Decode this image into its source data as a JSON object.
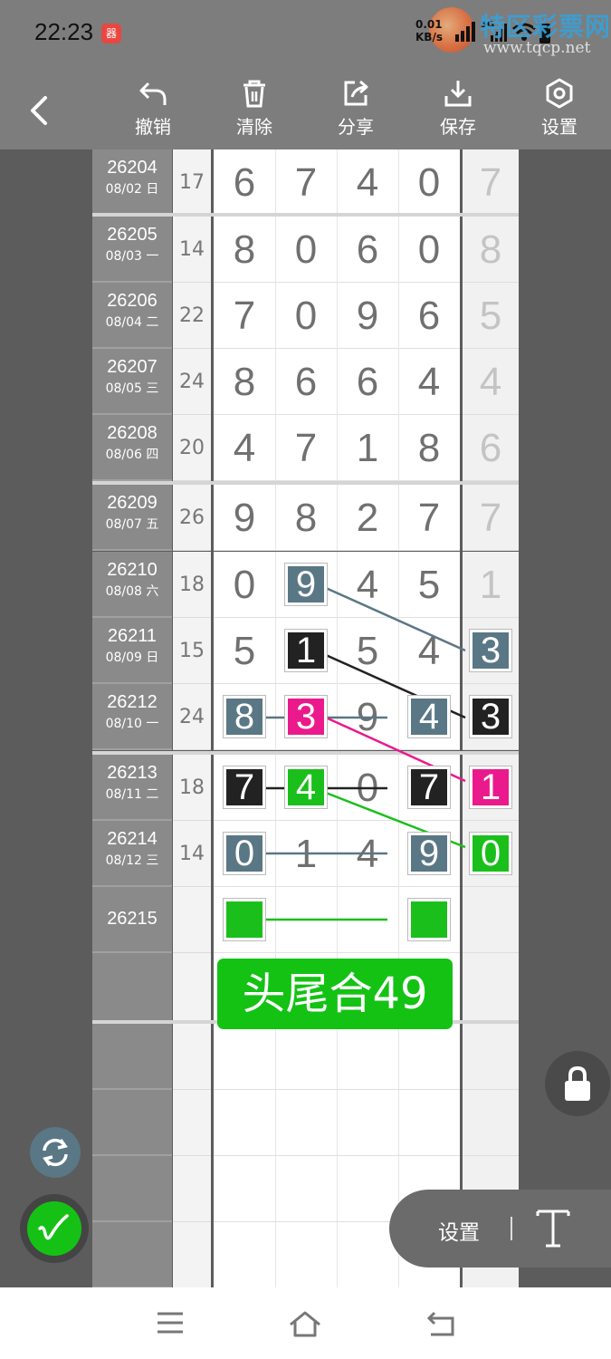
{
  "status": {
    "time": "22:23",
    "net_speed_top": "0.01",
    "net_speed_bottom": "KB/s",
    "network_tag": "5G",
    "app_badge": "器"
  },
  "watermark": {
    "title": "特区彩票网",
    "url": "www.tqcp.net"
  },
  "toolbar": {
    "undo_label": "撤销",
    "clear_label": "清除",
    "share_label": "分享",
    "save_label": "保存",
    "settings_label": "设置"
  },
  "rows": [
    {
      "issue": "26204",
      "date": "08/02 日",
      "sum": "17",
      "digits": [
        "6",
        "7",
        "4",
        "0"
      ],
      "tail": "7"
    },
    {
      "issue": "26205",
      "date": "08/03 一",
      "sum": "14",
      "digits": [
        "8",
        "0",
        "6",
        "0"
      ],
      "tail": "8"
    },
    {
      "issue": "26206",
      "date": "08/04 二",
      "sum": "22",
      "digits": [
        "7",
        "0",
        "9",
        "6"
      ],
      "tail": "5"
    },
    {
      "issue": "26207",
      "date": "08/05 三",
      "sum": "24",
      "digits": [
        "8",
        "6",
        "6",
        "4"
      ],
      "tail": "4"
    },
    {
      "issue": "26208",
      "date": "08/06 四",
      "sum": "20",
      "digits": [
        "4",
        "7",
        "1",
        "8"
      ],
      "tail": "6"
    },
    {
      "issue": "26209",
      "date": "08/07 五",
      "sum": "26",
      "digits": [
        "9",
        "8",
        "2",
        "7"
      ],
      "tail": "7"
    },
    {
      "issue": "26210",
      "date": "08/08 六",
      "sum": "18",
      "digits": [
        "0",
        "9",
        "4",
        "5"
      ],
      "tail": "1"
    },
    {
      "issue": "26211",
      "date": "08/09 日",
      "sum": "15",
      "digits": [
        "5",
        "1",
        "5",
        "4"
      ],
      "tail": "3"
    },
    {
      "issue": "26212",
      "date": "08/10 一",
      "sum": "24",
      "digits": [
        "8",
        "3",
        "9",
        "4"
      ],
      "tail": "3"
    },
    {
      "issue": "26213",
      "date": "08/11 二",
      "sum": "18",
      "digits": [
        "7",
        "4",
        "0",
        "7"
      ],
      "tail": "1"
    },
    {
      "issue": "26214",
      "date": "08/12 三",
      "sum": "14",
      "digits": [
        "0",
        "1",
        "4",
        "9"
      ],
      "tail": "0"
    },
    {
      "issue": "26215",
      "date": "",
      "sum": "",
      "digits": [
        "",
        "",
        "",
        ""
      ],
      "tail": ""
    }
  ],
  "banner_text": "头尾合49",
  "floating": {
    "settings_label": "设置"
  },
  "colors": {
    "slate": "#5a7785",
    "black": "#222222",
    "pink": "#ea1a8c",
    "green": "#1bbf1b"
  },
  "icons": [
    "back-chevron-icon",
    "undo-icon",
    "trash-icon",
    "share-icon",
    "download-icon",
    "gear-icon",
    "lock-icon",
    "refresh-icon",
    "pen-icon",
    "text-icon",
    "menu-icon",
    "home-icon",
    "back-nav-icon"
  ]
}
